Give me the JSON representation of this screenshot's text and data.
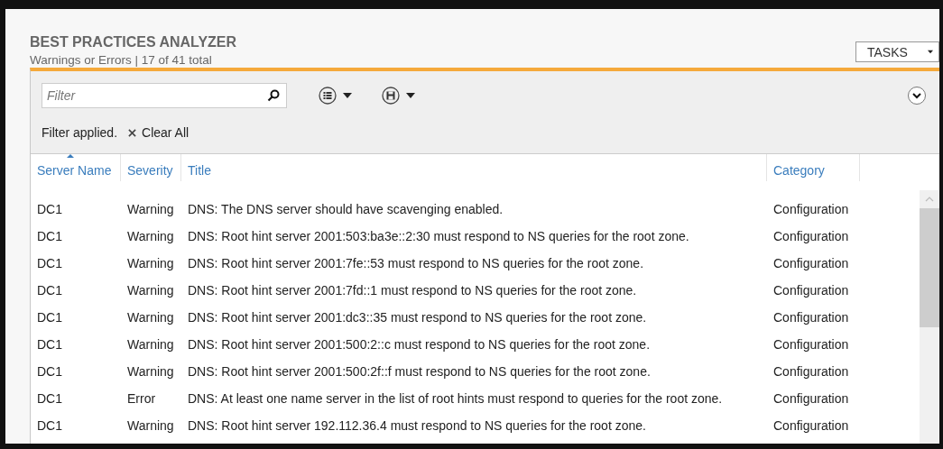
{
  "header": {
    "title": "BEST PRACTICES ANALYZER",
    "subtitle": "Warnings or Errors | 17 of 41 total",
    "tasks_button": "TASKS"
  },
  "toolbar": {
    "filter": {
      "placeholder": "Filter"
    },
    "filter_status": "Filter applied.",
    "clear_all": "Clear All"
  },
  "table": {
    "columns": [
      {
        "label": "Server Name",
        "sorted": true
      },
      {
        "label": "Severity",
        "sorted": false
      },
      {
        "label": "Title",
        "sorted": false
      },
      {
        "label": "Category",
        "sorted": false
      }
    ],
    "rows": [
      {
        "server": "DC1",
        "severity": "Warning",
        "title": "DNS: The DNS server should have scavenging enabled.",
        "category": "Configuration"
      },
      {
        "server": "DC1",
        "severity": "Warning",
        "title": "DNS: Root hint server 2001:503:ba3e::2:30 must respond to NS queries for the root zone.",
        "category": "Configuration"
      },
      {
        "server": "DC1",
        "severity": "Warning",
        "title": "DNS: Root hint server 2001:7fe::53 must respond to NS queries for the root zone.",
        "category": "Configuration"
      },
      {
        "server": "DC1",
        "severity": "Warning",
        "title": "DNS: Root hint server 2001:7fd::1 must respond to NS queries for the root zone.",
        "category": "Configuration"
      },
      {
        "server": "DC1",
        "severity": "Warning",
        "title": "DNS: Root hint server 2001:dc3::35 must respond to NS queries for the root zone.",
        "category": "Configuration"
      },
      {
        "server": "DC1",
        "severity": "Warning",
        "title": "DNS: Root hint server 2001:500:2::c must respond to NS queries for the root zone.",
        "category": "Configuration"
      },
      {
        "server": "DC1",
        "severity": "Warning",
        "title": "DNS: Root hint server 2001:500:2f::f must respond to NS queries for the root zone.",
        "category": "Configuration"
      },
      {
        "server": "DC1",
        "severity": "Error",
        "title": "DNS: At least one name server in the list of root hints must respond to queries for the root zone.",
        "category": "Configuration"
      },
      {
        "server": "DC1",
        "severity": "Warning",
        "title": "DNS: Root hint server 192.112.36.4 must respond to NS queries for the root zone.",
        "category": "Configuration"
      }
    ]
  }
}
